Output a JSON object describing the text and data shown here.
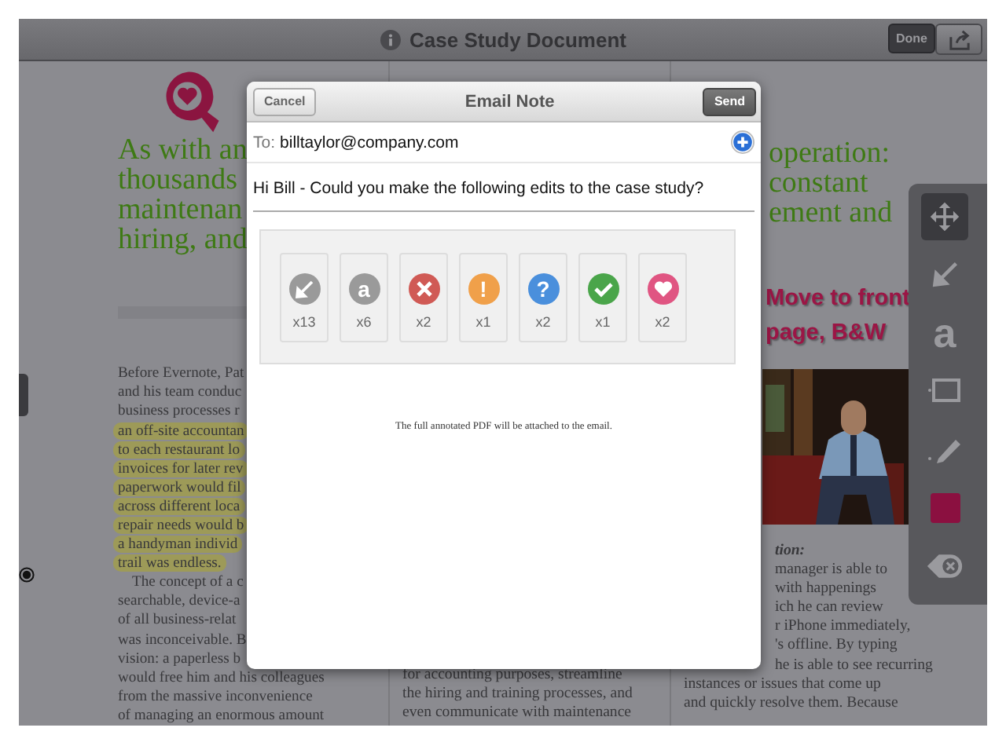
{
  "top_bar": {
    "title": "Case Study Document",
    "done_button": "Done"
  },
  "document": {
    "left_heading": [
      "As with an",
      "thousands",
      "maintenan",
      "hiring, and"
    ],
    "left_body": [
      {
        "text": "Before Evernote, Pat",
        "highlighted": false,
        "indent": false
      },
      {
        "text": "and his team conduc",
        "highlighted": false,
        "indent": false
      },
      {
        "text": "business processes r",
        "highlighted": false,
        "indent": false
      },
      {
        "text": "an off-site accountan",
        "highlighted": true,
        "indent": false
      },
      {
        "text": "to each restaurant lo",
        "highlighted": true,
        "indent": false
      },
      {
        "text": "invoices for later rev",
        "highlighted": true,
        "indent": false
      },
      {
        "text": "paperwork would fil",
        "highlighted": true,
        "indent": false
      },
      {
        "text": "across different loca",
        "highlighted": true,
        "indent": false
      },
      {
        "text": "repair needs would b",
        "highlighted": true,
        "indent": false
      },
      {
        "text": "a handyman individ",
        "highlighted": true,
        "indent": false
      },
      {
        "text": "trail was endless.",
        "highlighted": true,
        "indent": false
      },
      {
        "text": "The concept of a c",
        "highlighted": false,
        "indent": true
      },
      {
        "text": "searchable, device-a",
        "highlighted": false,
        "indent": false
      },
      {
        "text": "of all business-relat",
        "highlighted": false,
        "indent": false
      },
      {
        "text": "was inconceivable. B",
        "highlighted": false,
        "indent": false
      },
      {
        "text": "vision: a paperless b",
        "highlighted": false,
        "indent": false
      },
      {
        "text": "would free him and his colleagues",
        "highlighted": false,
        "indent": false
      },
      {
        "text": "from the massive inconvenience",
        "highlighted": false,
        "indent": false
      },
      {
        "text": "of managing an enormous amount",
        "highlighted": false,
        "indent": false
      }
    ],
    "middle_body": [
      "for accounting purposes, streamline",
      "the hiring and training processes, and",
      "even communicate with maintenance"
    ],
    "right_heading": [
      "operation:",
      "constant",
      "ement and"
    ],
    "annotation_note": [
      "Move to front",
      "page, B&W"
    ],
    "photo": {
      "kind": "picture"
    },
    "right_subheading": "tion:",
    "right_body": [
      {
        "text": "manager is able to",
        "fragment": true
      },
      {
        "text": "with happenings",
        "fragment": true
      },
      {
        "text": "ich he can review",
        "fragment": true
      },
      {
        "text": "r iPhone immediately,",
        "fragment": true
      },
      {
        "text": "'s offline. By typing",
        "fragment": true
      },
      {
        "text": "he is able to see recurring",
        "fragment": true
      },
      {
        "text": "instances or issues that come up",
        "fragment": false
      },
      {
        "text": "and quickly resolve them. Because",
        "fragment": false
      }
    ]
  },
  "toolbar": {
    "tools": [
      {
        "kind": "move",
        "selected": true
      },
      {
        "kind": "arrow",
        "selected": false
      },
      {
        "kind": "text",
        "label": "a",
        "selected": false
      },
      {
        "kind": "rectangle",
        "selected": false
      },
      {
        "kind": "pen",
        "selected": false
      },
      {
        "kind": "color",
        "color": "#8b1040",
        "selected": false
      },
      {
        "kind": "delete",
        "selected": false
      }
    ]
  },
  "email_dialog": {
    "title": "Email Note",
    "cancel": "Cancel",
    "send": "Send",
    "to_label": "To:",
    "to": "billtaylor@company.com",
    "message": "Hi Bill - Could you make the following edits to the case study?",
    "annotations": [
      {
        "kind": "arrow",
        "color": "#9a9a9a",
        "count": "x13"
      },
      {
        "kind": "glyph",
        "glyph": "a",
        "color": "#9a9a9a",
        "count": "x6"
      },
      {
        "kind": "cross",
        "color": "#d05a55",
        "count": "x2"
      },
      {
        "kind": "glyph",
        "glyph": "!",
        "color": "#f0a04a",
        "count": "x1"
      },
      {
        "kind": "glyph",
        "glyph": "?",
        "color": "#4a8fdc",
        "count": "x2"
      },
      {
        "kind": "check",
        "color": "#4aa54a",
        "count": "x1"
      },
      {
        "kind": "heart",
        "color": "#e05582",
        "count": "x2"
      }
    ],
    "footer": "The full annotated PDF will be attached to the email."
  }
}
